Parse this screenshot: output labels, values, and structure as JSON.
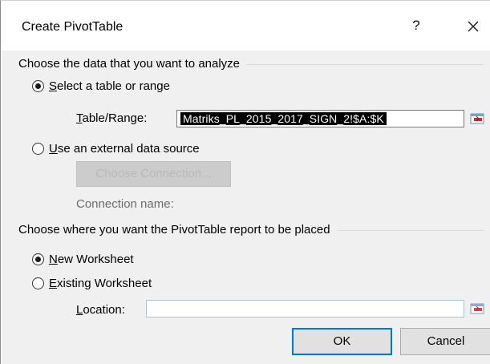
{
  "window": {
    "title": "Create PivotTable",
    "help_label": "?"
  },
  "analyze_group": {
    "title": "Choose the data that you want to analyze",
    "select_range": {
      "selected": true,
      "label_underlined": "S",
      "label_rest": "elect a table or range"
    },
    "table_range": {
      "label_underlined": "T",
      "label_rest": "able/Range:",
      "value": "Matriks_PL_2015_2017_SIGN_2!$A:$K"
    },
    "external_source": {
      "selected": false,
      "label_underlined": "U",
      "label_rest": "se an external data source"
    },
    "choose_connection_label": "Choose Connection...",
    "connection_name_label": "Connection name:"
  },
  "placement_group": {
    "title": "Choose where you want the PivotTable report to be placed",
    "new_worksheet": {
      "selected": true,
      "label_underlined": "N",
      "label_rest": "ew Worksheet"
    },
    "existing_worksheet": {
      "selected": false,
      "label_underlined": "E",
      "label_rest": "xisting Worksheet"
    },
    "location": {
      "label_underlined": "L",
      "label_rest": "ocation:",
      "value": ""
    }
  },
  "buttons": {
    "ok_label": "OK",
    "cancel_label": "Cancel"
  },
  "colors": {
    "dialog_background": "#f0f0f0",
    "titlebar_background": "#ffffff",
    "accent_focus": "#0078d7",
    "selection_highlight": "#000000",
    "range_icon_red": "#d9262a"
  },
  "icons": {
    "close": "close-x-icon",
    "range_selector": "collapse-dialog-icon"
  }
}
